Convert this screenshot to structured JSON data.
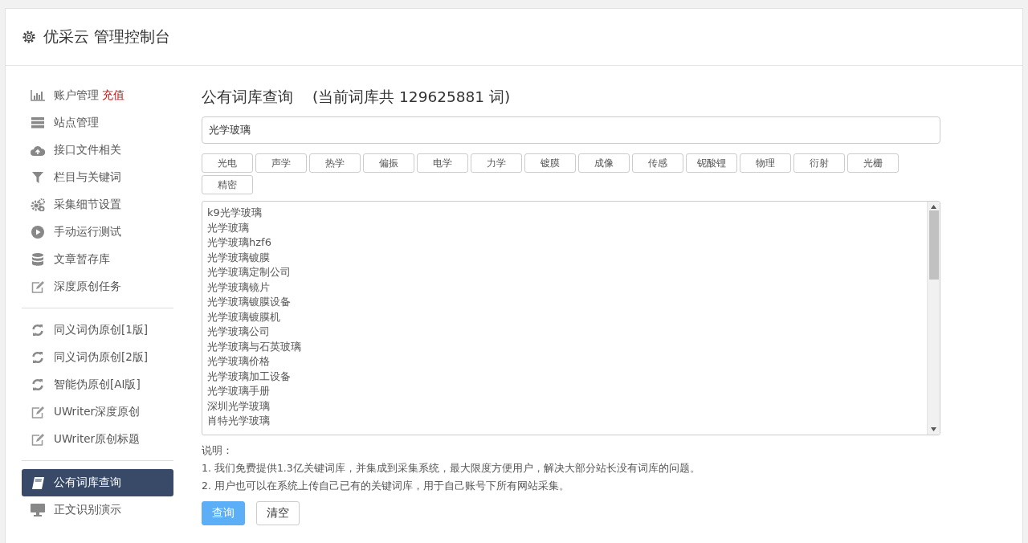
{
  "header": {
    "title": "优采云 管理控制台"
  },
  "sidebar": {
    "groups": [
      {
        "items": [
          {
            "label": "账户管理",
            "badge": "充值",
            "kind": "chart",
            "selected": false
          },
          {
            "label": "站点管理",
            "kind": "server",
            "selected": false
          },
          {
            "label": "接口文件相关",
            "kind": "cloud",
            "selected": false
          },
          {
            "label": "栏目与关键词",
            "kind": "filter",
            "selected": false
          },
          {
            "label": "采集细节设置",
            "kind": "gears",
            "selected": false
          },
          {
            "label": "手动运行测试",
            "kind": "play",
            "selected": false
          },
          {
            "label": "文章暂存库",
            "kind": "database",
            "selected": false
          },
          {
            "label": "深度原创任务",
            "kind": "edit",
            "selected": false
          }
        ]
      },
      {
        "items": [
          {
            "label": "同义词伪原创[1版]",
            "kind": "refresh",
            "selected": false
          },
          {
            "label": "同义词伪原创[2版]",
            "kind": "refresh",
            "selected": false
          },
          {
            "label": "智能伪原创[AI版]",
            "kind": "refresh",
            "selected": false
          },
          {
            "label": "UWriter深度原创",
            "kind": "edit",
            "selected": false
          },
          {
            "label": "UWriter原创标题",
            "kind": "edit",
            "selected": false
          }
        ]
      },
      {
        "items": [
          {
            "label": "公有词库查询",
            "kind": "book",
            "selected": true
          },
          {
            "label": "正文识别演示",
            "kind": "monitor",
            "selected": false
          }
        ]
      }
    ]
  },
  "main": {
    "title": "公有词库查询",
    "count_text": "(当前词库共 129625881 词)",
    "search": {
      "value": "光学玻璃"
    },
    "tags": [
      "光电",
      "声学",
      "热学",
      "偏振",
      "电学",
      "力学",
      "镀膜",
      "成像",
      "传感",
      "铌酸锂",
      "物理",
      "衍射",
      "光栅",
      "精密"
    ],
    "results": [
      "k9光学玻璃",
      "光学玻璃",
      "光学玻璃hzf6",
      "光学玻璃镀膜",
      "光学玻璃定制公司",
      "光学玻璃镜片",
      "光学玻璃镀膜设备",
      "光学玻璃镀膜机",
      "光学玻璃公司",
      "光学玻璃与石英玻璃",
      "光学玻璃价格",
      "光学玻璃加工设备",
      "光学玻璃手册",
      "深圳光学玻璃",
      "肖特光学玻璃"
    ],
    "notes_title": "说明：",
    "notes": [
      "1. 我们免费提供1.3亿关键词库，并集成到采集系统，最大限度方便用户，解决大部分站长没有词库的问题。",
      "2. 用户也可以在系统上传自己已有的关键词库，用于自己账号下所有网站采集。"
    ],
    "buttons": [
      {
        "label": "查询",
        "kind": "primary"
      },
      {
        "label": "清空",
        "kind": "default"
      }
    ]
  }
}
